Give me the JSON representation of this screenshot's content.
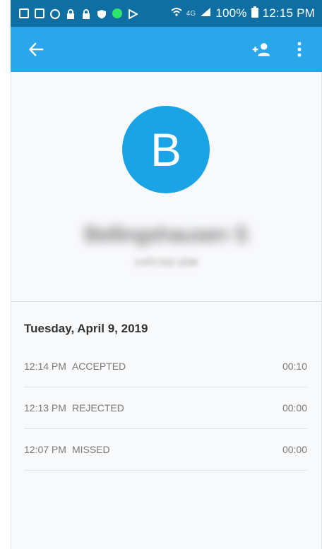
{
  "status_bar": {
    "battery": "100%",
    "time": "12:15 PM",
    "network": "4G",
    "left_icons": [
      "checkbox-icon",
      "gallery-icon",
      "browser-icon",
      "lock-icon",
      "lock-icon",
      "shield-icon",
      "green-dot-icon",
      "play-store-icon"
    ]
  },
  "toolbar": {
    "back_icon": "arrow-back-icon",
    "add_contact_icon": "person-add-icon",
    "more_icon": "more-vert-icon",
    "color": "#2aa7ea"
  },
  "profile": {
    "initial": "B",
    "name": "Bellingshausen S",
    "subtitle": "(+07) 512 1234",
    "avatar_color": "#1aa4e6"
  },
  "call_log": {
    "date": "Tuesday, April 9, 2019",
    "entries": [
      {
        "time": "12:14 PM",
        "status": "ACCEPTED",
        "duration": "00:10"
      },
      {
        "time": "12:13 PM",
        "status": "REJECTED",
        "duration": "00:00"
      },
      {
        "time": "12:07 PM",
        "status": "MISSED",
        "duration": "00:00"
      }
    ]
  }
}
